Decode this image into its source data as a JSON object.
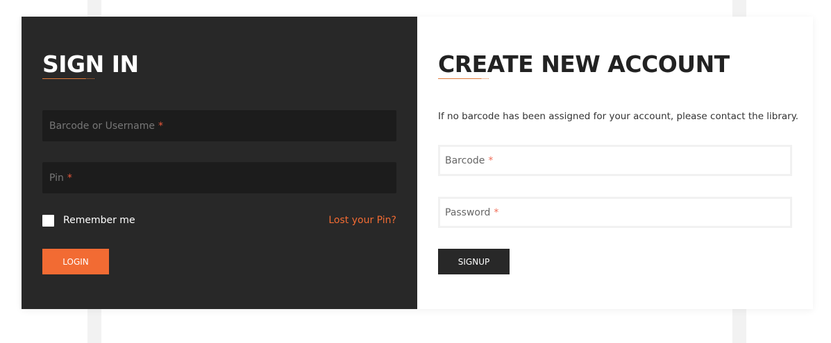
{
  "signin": {
    "title": "SIGN IN",
    "username_placeholder": "Barcode or Username",
    "pin_placeholder": "Pin",
    "required_mark": "*",
    "remember_label": "Remember me",
    "lost_pin_link": "Lost your Pin?",
    "login_button": "LOGIN"
  },
  "signup": {
    "title": "CREATE NEW ACCOUNT",
    "info": "If no barcode has been assigned for your account, please contact the library.",
    "barcode_placeholder": "Barcode",
    "password_placeholder": "Password",
    "required_mark": "*",
    "signup_button": "SIGNUP"
  },
  "colors": {
    "accent": "#f26b33",
    "dark_panel": "#282828",
    "required": "#e8573a"
  }
}
